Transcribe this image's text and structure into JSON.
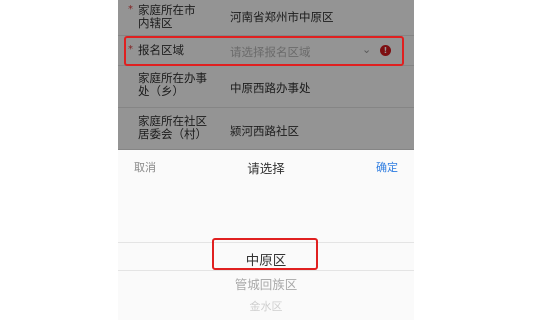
{
  "form": {
    "rows": [
      {
        "label": "家庭所在市\n内辖区",
        "value": "河南省郑州市中原区",
        "required": true
      },
      {
        "label": "报名区域",
        "placeholder": "请选择报名区域",
        "required": true
      },
      {
        "label": "家庭所在办事\n处（乡）",
        "value": "中原西路办事处"
      },
      {
        "label": "家庭所在社区\n居委会（村）",
        "value": "颍河西路社区"
      }
    ],
    "required_mark": "*",
    "error_icon_glyph": "!",
    "chevron_glyph": "⌄"
  },
  "picker": {
    "cancel_label": "取消",
    "title": "请选择",
    "confirm_label": "确定",
    "options": [
      "中原区",
      "管城回族区",
      "金水区"
    ],
    "selected_index": 0
  },
  "colors": {
    "highlight_red": "#e02020",
    "error_red": "#d8191e",
    "confirm_blue": "#2f7de1"
  }
}
